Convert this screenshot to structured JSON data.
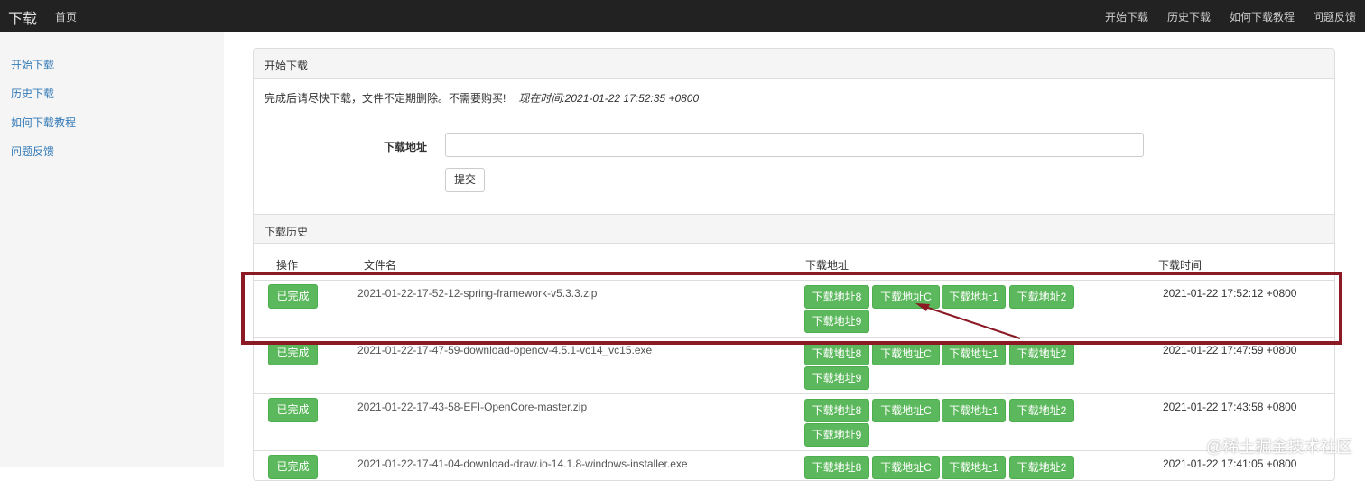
{
  "navbar": {
    "brand": "下载",
    "home": "首页",
    "right_links": [
      "开始下载",
      "历史下载",
      "如何下载教程",
      "问题反馈"
    ]
  },
  "sidebar": {
    "items": [
      "开始下载",
      "历史下载",
      "如何下载教程",
      "问题反馈"
    ]
  },
  "start_panel": {
    "heading": "开始下载",
    "notice": "完成后请尽快下载，文件不定期删除。不需要购买!",
    "current_time": "现在时间:2021-01-22 17:52:35 +0800",
    "url_label": "下载地址",
    "url_value": "",
    "submit_label": "提交"
  },
  "history_panel": {
    "heading": "下载历史",
    "columns": [
      "操作",
      "文件名",
      "下载地址",
      "下载时间"
    ],
    "rows": [
      {
        "status": "已完成",
        "filename": "2021-01-22-17-52-12-spring-framework-v5.3.3.zip",
        "links": [
          "下载地址8",
          "下载地址C",
          "下载地址1",
          "下载地址2",
          "下载地址9"
        ],
        "time": "2021-01-22 17:52:12 +0800"
      },
      {
        "status": "已完成",
        "filename": "2021-01-22-17-47-59-download-opencv-4.5.1-vc14_vc15.exe",
        "links": [
          "下载地址8",
          "下载地址C",
          "下载地址1",
          "下载地址2",
          "下载地址9"
        ],
        "time": "2021-01-22 17:47:59 +0800"
      },
      {
        "status": "已完成",
        "filename": "2021-01-22-17-43-58-EFI-OpenCore-master.zip",
        "links": [
          "下载地址8",
          "下载地址C",
          "下载地址1",
          "下载地址2",
          "下载地址9"
        ],
        "time": "2021-01-22 17:43:58 +0800"
      },
      {
        "status": "已完成",
        "filename": "2021-01-22-17-41-04-download-draw.io-14.1.8-windows-installer.exe",
        "links": [
          "下载地址8",
          "下载地址C",
          "下载地址1",
          "下载地址2"
        ],
        "time": "2021-01-22 17:41:05 +0800"
      }
    ]
  },
  "watermark": "@稀土掘金技术社区",
  "colors": {
    "navbar": "#222222",
    "button_green": "#5cb85c",
    "highlight": "#8b1a24",
    "link": "#337ab7"
  }
}
